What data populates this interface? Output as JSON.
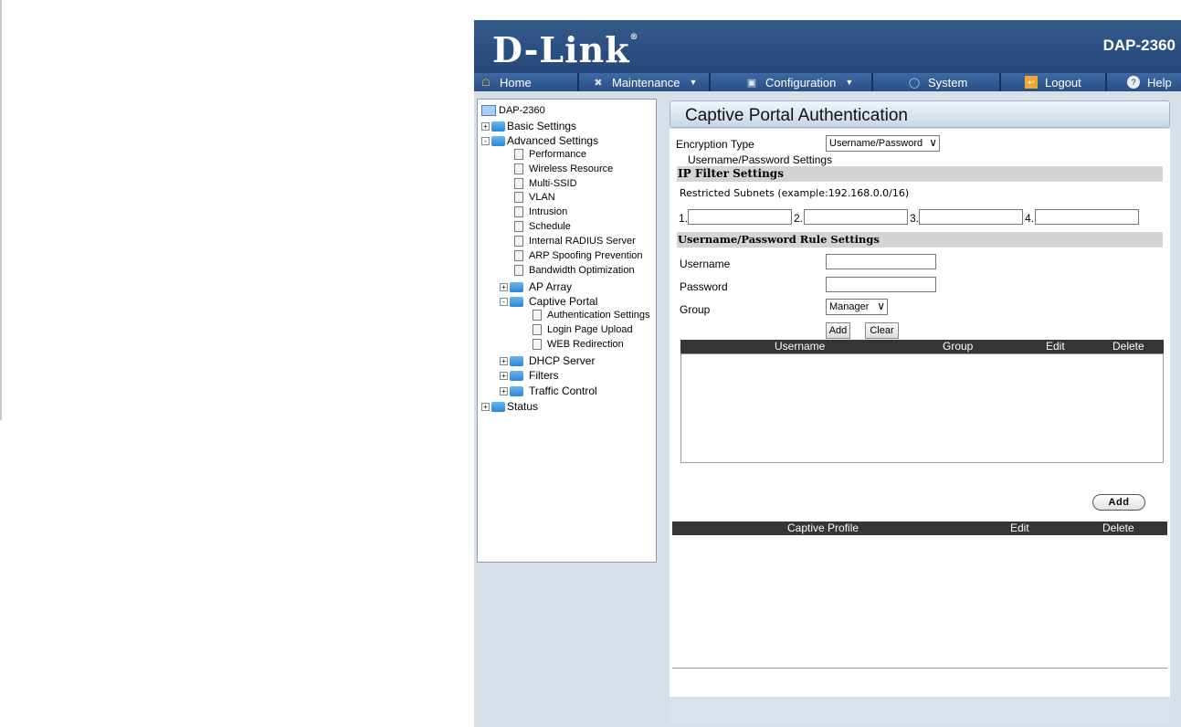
{
  "brand": {
    "logo": "D-Link",
    "model": "DAP-2360"
  },
  "menu": [
    {
      "label": "Home",
      "icon": "home-icon",
      "dropdown": false
    },
    {
      "label": "Maintenance",
      "icon": "tools-icon",
      "dropdown": true
    },
    {
      "label": "Configuration",
      "icon": "save-icon",
      "dropdown": true
    },
    {
      "label": "System",
      "icon": "system-icon",
      "dropdown": false
    },
    {
      "label": "Logout",
      "icon": "logout-icon",
      "dropdown": false
    },
    {
      "label": "Help",
      "icon": "help-icon",
      "dropdown": false
    }
  ],
  "tree": [
    {
      "label": "DAP-2360",
      "type": "root"
    },
    {
      "label": "Basic Settings",
      "type": "folder",
      "toggle": "+"
    },
    {
      "label": "Advanced Settings",
      "type": "folder",
      "toggle": "-"
    },
    {
      "label": "Performance",
      "type": "page"
    },
    {
      "label": "Wireless Resource",
      "type": "page"
    },
    {
      "label": "Multi-SSID",
      "type": "page"
    },
    {
      "label": "VLAN",
      "type": "page"
    },
    {
      "label": "Intrusion",
      "type": "page"
    },
    {
      "label": "Schedule",
      "type": "page"
    },
    {
      "label": "Internal RADIUS Server",
      "type": "page"
    },
    {
      "label": "ARP Spoofing Prevention",
      "type": "page"
    },
    {
      "label": "Bandwidth Optimization",
      "type": "page"
    },
    {
      "label": "AP Array",
      "type": "folder",
      "toggle": "+"
    },
    {
      "label": "Captive Portal",
      "type": "folder",
      "toggle": "-"
    },
    {
      "label": "Authentication Settings",
      "type": "page"
    },
    {
      "label": "Login Page Upload",
      "type": "page"
    },
    {
      "label": "WEB Redirection",
      "type": "page"
    },
    {
      "label": "DHCP Server",
      "type": "folder",
      "toggle": "+"
    },
    {
      "label": "Filters",
      "type": "folder",
      "toggle": "+"
    },
    {
      "label": "Traffic Control",
      "type": "folder",
      "toggle": "+"
    },
    {
      "label": "Status",
      "type": "folder",
      "toggle": "+"
    }
  ],
  "page": {
    "title": "Captive Portal Authentication",
    "encryption_label": "Encryption Type",
    "encryption_value": "Username/Password",
    "subheading": "Username/Password Settings",
    "ip_filter_title": "IP Filter Settings",
    "restricted_label": "Restricted Subnets (example:192.168.0.0/16)",
    "subnet_labels": [
      "1.",
      "2.",
      "3.",
      "4."
    ],
    "rule_title": "Username/Password Rule Settings",
    "username_label": "Username",
    "password_label": "Password",
    "group_label": "Group",
    "group_value": "Manager",
    "add_label": "Add",
    "clear_label": "Clear",
    "user_table_headers": [
      "Username",
      "Group",
      "Edit",
      "Delete"
    ],
    "profile_add_label": "Add",
    "profile_table_headers": [
      "Captive Profile",
      "Edit",
      "Delete"
    ]
  }
}
